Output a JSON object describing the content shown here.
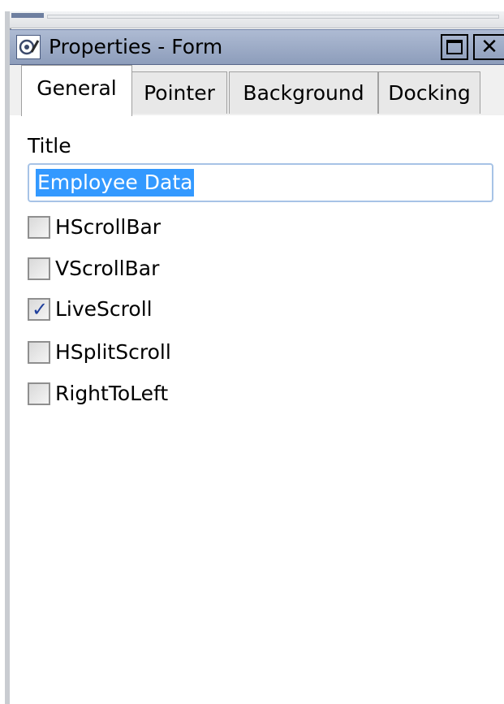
{
  "window": {
    "title": "Properties - Form",
    "maximize_label": "",
    "close_label": "✕"
  },
  "tabs": [
    {
      "label": "General",
      "active": true
    },
    {
      "label": "Pointer",
      "active": false
    },
    {
      "label": "Background",
      "active": false
    },
    {
      "label": "Docking",
      "active": false
    }
  ],
  "general": {
    "title_label": "Title",
    "title_value": "Employee Data",
    "options": [
      {
        "label": "HScrollBar",
        "checked": false
      },
      {
        "label": "VScrollBar",
        "checked": false
      },
      {
        "label": "LiveScroll",
        "checked": true
      },
      {
        "label": "HSplitScroll",
        "checked": false
      },
      {
        "label": "RightToLeft",
        "checked": false
      }
    ]
  },
  "colors": {
    "titlebar": "#9aa9c6",
    "selection": "#3399ff",
    "input_border": "#a7c3e6"
  }
}
